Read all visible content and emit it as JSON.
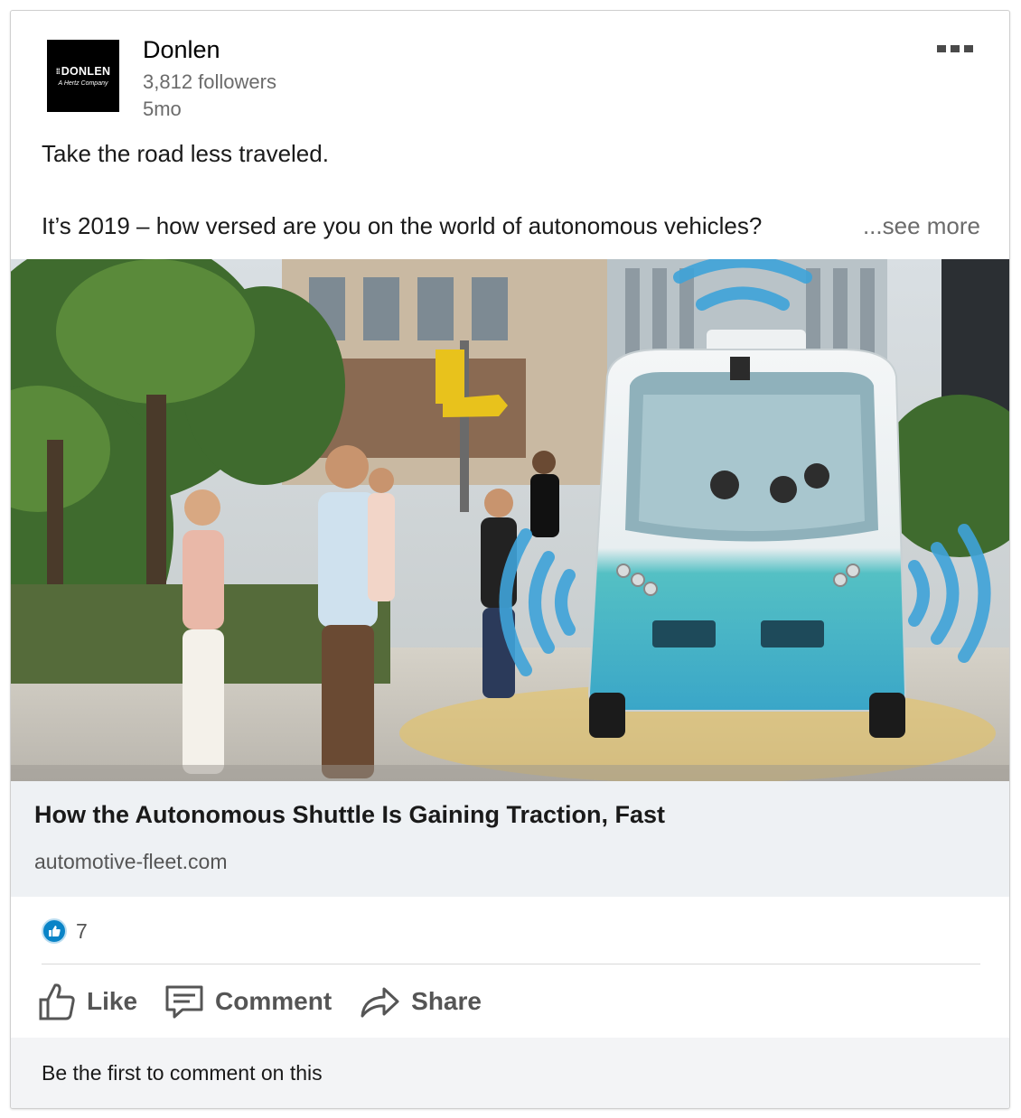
{
  "post": {
    "company_name": "Donlen",
    "followers": "3,812 followers",
    "age": "5mo",
    "logo_text": "DONLEN",
    "logo_tagline": "A Hertz Company",
    "text_line1": "Take the road less traveled.",
    "text_line2": "It’s 2019 – how versed are you on the world of autonomous vehicles?",
    "see_more": "...see more"
  },
  "link": {
    "title": "How the Autonomous Shuttle Is Gaining Traction, Fast",
    "domain": "automotive-fleet.com"
  },
  "social": {
    "reaction_count": "7",
    "like_label": "Like",
    "comment_label": "Comment",
    "share_label": "Share"
  },
  "footer": {
    "text": "Be the first to comment on this"
  },
  "colors": {
    "like_blue": "#0a84c7",
    "link_bg": "#eef1f4",
    "shuttle_teal": "#5fc3c8",
    "signal_blue": "#3fa3d9"
  }
}
